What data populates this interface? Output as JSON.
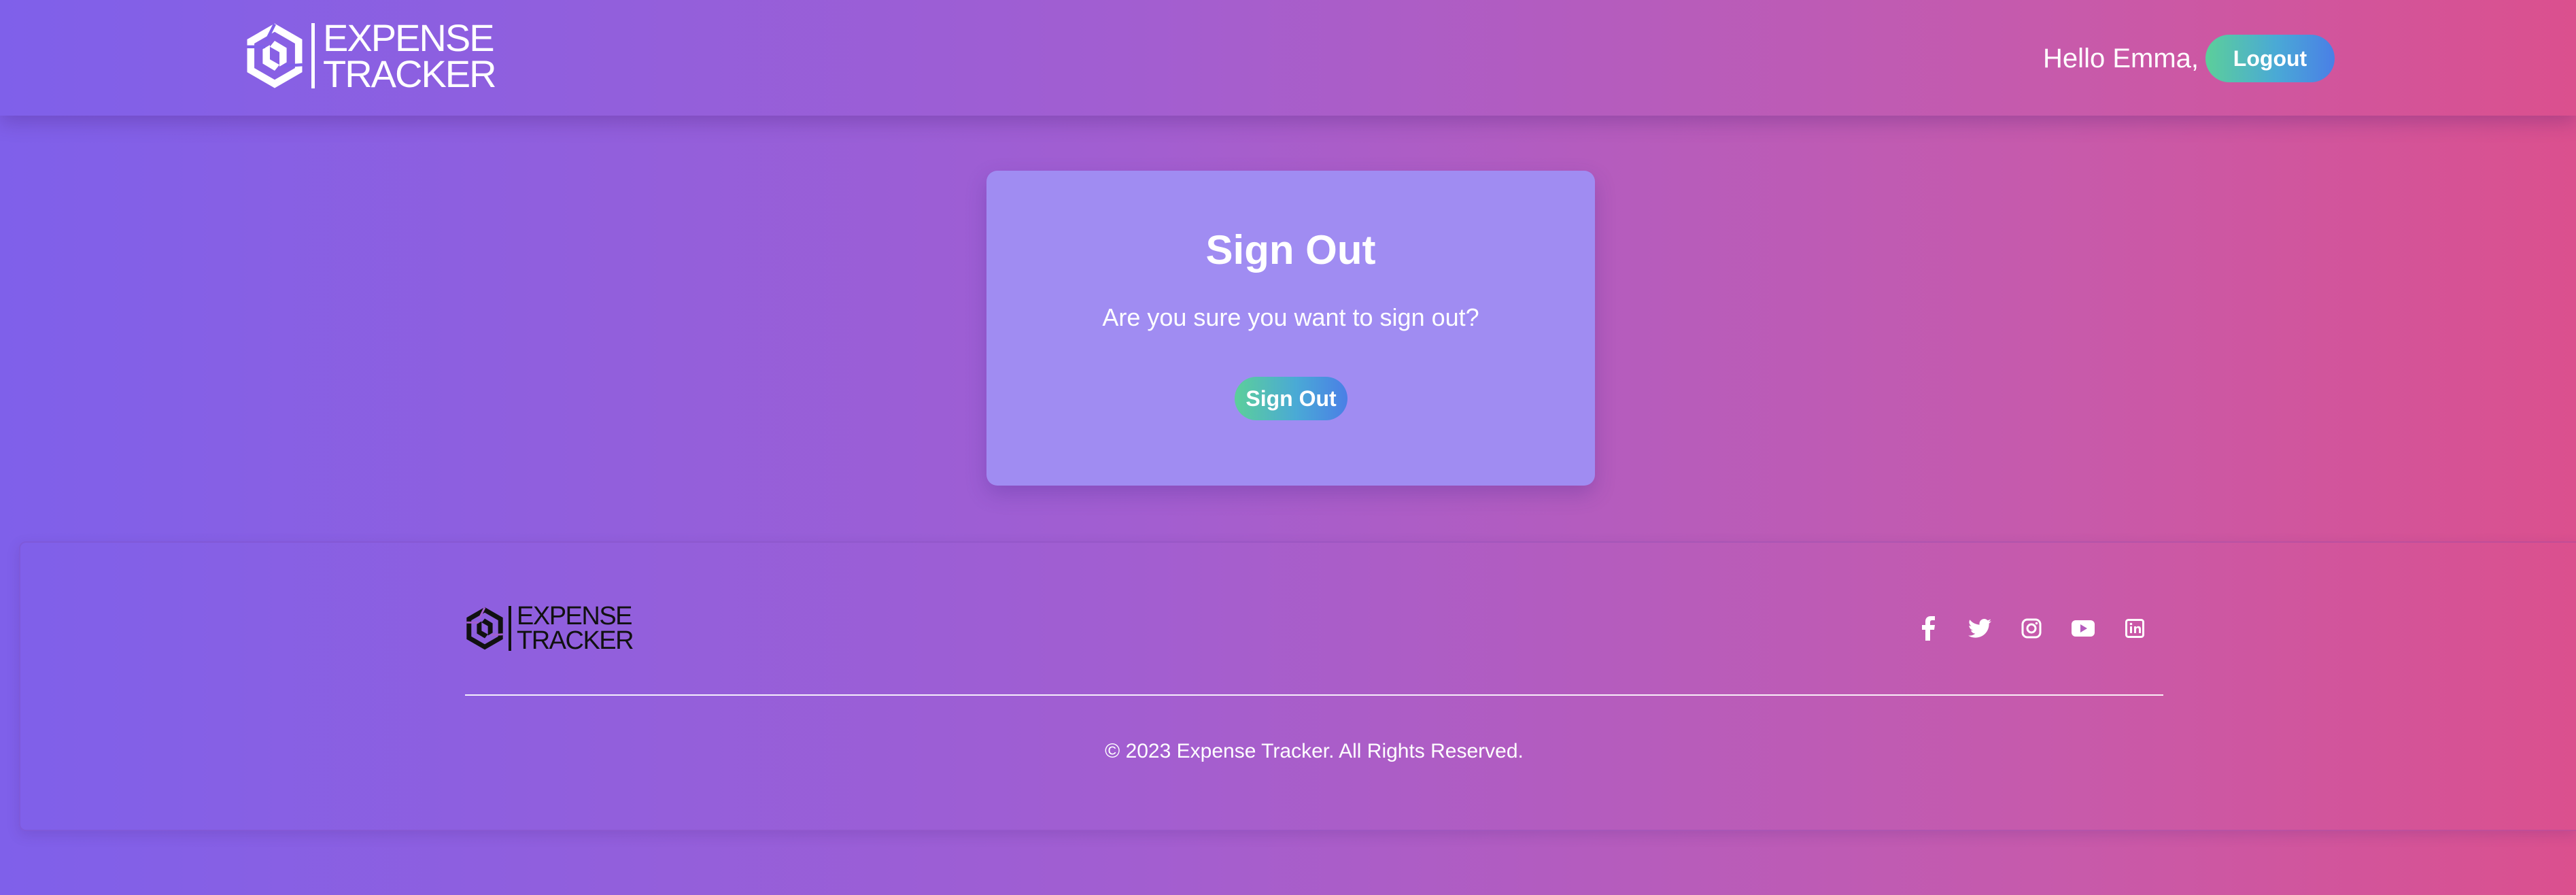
{
  "header": {
    "brand": {
      "line1": "EXPENSE",
      "line2": "TRACKER"
    },
    "greeting": "Hello Emma,",
    "logout_label": "Logout"
  },
  "card": {
    "title": "Sign Out",
    "message": "Are you sure you want to sign out?",
    "button_label": "Sign Out"
  },
  "footer": {
    "brand": {
      "line1": "EXPENSE",
      "line2": "TRACKER"
    },
    "socials": [
      {
        "icon": "facebook-icon"
      },
      {
        "icon": "twitter-icon"
      },
      {
        "icon": "instagram-icon"
      },
      {
        "icon": "youtube-icon"
      },
      {
        "icon": "linkedin-icon"
      }
    ],
    "copyright": "© 2023 Expense Tracker. All Rights Reserved."
  },
  "colors": {
    "background_start": "#7f60ea",
    "background_end": "#db508e",
    "card": "#a08cf2",
    "button_start": "#5ccf9a",
    "button_end": "#4a7fe6",
    "footer_logo": "#111111"
  }
}
